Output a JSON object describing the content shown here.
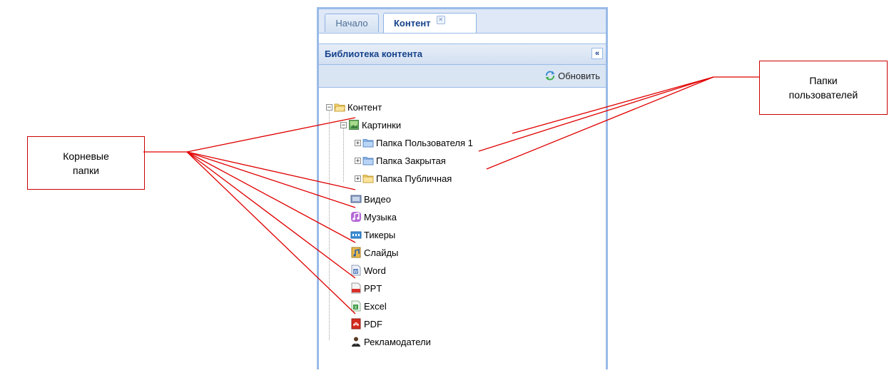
{
  "tabs": [
    {
      "label": "Начало",
      "active": false
    },
    {
      "label": "Контент",
      "active": true,
      "closable": true
    }
  ],
  "panel": {
    "title": "Библиотека контента",
    "collapse_icon": "double-chevron-left-icon",
    "refresh_label": "Обновить"
  },
  "tree": {
    "root": "Контент",
    "pictures": "Картинки",
    "user_folder_1": "Папка Пользователя 1",
    "closed_folder": "Папка Закрытая",
    "public_folder": "Папка Публичная",
    "video": "Видео",
    "music": "Музыка",
    "tickers": "Тикеры",
    "slides": "Слайды",
    "word": "Word",
    "ppt": "PPT",
    "excel": "Excel",
    "pdf": "PDF",
    "advertisers": "Рекламодатели"
  },
  "callouts": {
    "root_folders": "Корневые\nпапки",
    "user_folders": "Папки\nпользователей"
  },
  "colors": {
    "callout_line": "#e00000",
    "panel_border": "#99bbe8",
    "header_text": "#15428b"
  }
}
